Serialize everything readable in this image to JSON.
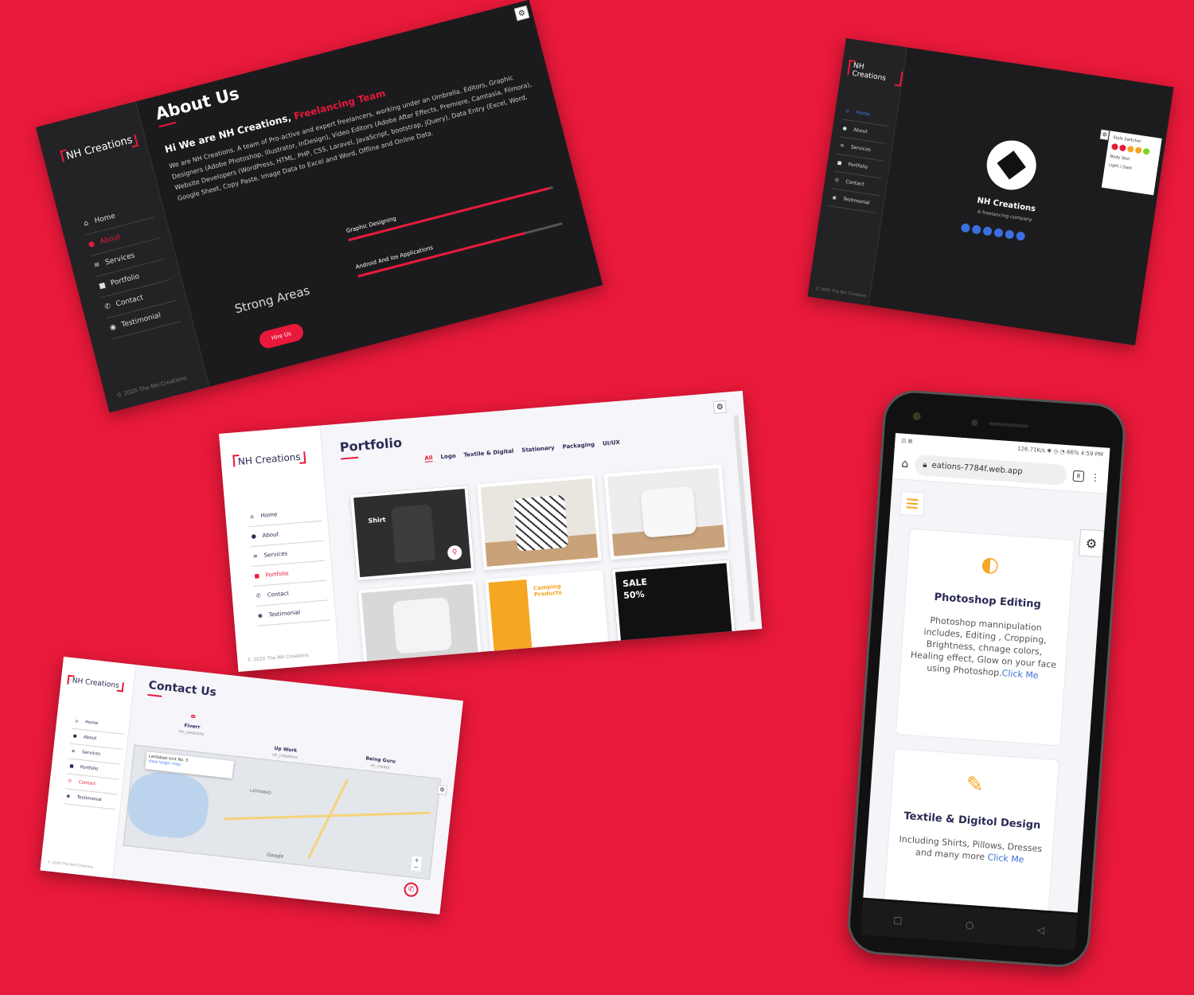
{
  "about_shot": {
    "logo": "NH Creations",
    "nav": [
      "Home",
      "About",
      "Services",
      "Portfolio",
      "Contact",
      "Testimonial"
    ],
    "copyright": "© 2020 The NH Creations",
    "title": "About Us",
    "intro_prefix": "Hi We are NH Creations,",
    "intro_highlight": "Freelancing Team",
    "description": "We are NH Creations. A team of Pro-active and expert freelancers, working under an Umbrella. Editors, Graphic Designers (Adobe Photoshop, Illustrator, InDesign), Video Editors (Adobe After Effects, Premiere, Camtasia, Filmora), Website Developers (WordPress, HTML, PHP, CSS, Laravel, JavaScript, bootstrap, jQuery), Data Entry (Excel, Word, Google Sheet, Copy Paste, Image Data to Excel and Word, Offline and Online Data.",
    "strong_areas": "Strong Areas",
    "hire_button": "Hire Us",
    "skills": [
      {
        "name": "Graphic Designing",
        "level": 0.98
      },
      {
        "name": "Android And Ios Applications",
        "level": 0.82
      }
    ]
  },
  "home_shot": {
    "logo": "NH Creations",
    "nav": [
      "Home",
      "About",
      "Services",
      "Portfolio",
      "Contact",
      "Testimonial"
    ],
    "copyright": "© 2020 The NH Creations",
    "name": "NH Creations",
    "tagline": "A freelancing company",
    "style_panel": {
      "title": "Style Switcher",
      "colors": [
        "#e8193a",
        "#e8193a",
        "#f5a623",
        "#f5a623",
        "#7ed321"
      ],
      "body_skin": "Body Skin",
      "option": "Light / Dark"
    }
  },
  "portfolio_shot": {
    "logo": "NH Creations",
    "nav": [
      "Home",
      "About",
      "Services",
      "Portfolio",
      "Contact",
      "Testimonial"
    ],
    "copyright": "© 2020 The NH Creations",
    "title": "Portfolio",
    "filters": [
      "All",
      "Logo",
      "Textile & Digital",
      "Stationary",
      "Packaging",
      "UI/UX"
    ],
    "card_caption": "Shirt",
    "camping_text": "Camping Products",
    "sale_text": "SALE",
    "sale_pct": "50%"
  },
  "contact_shot": {
    "logo": "NH Creations",
    "nav": [
      "Home",
      "About",
      "Services",
      "Portfolio",
      "Contact",
      "Testimonial"
    ],
    "copyright": "© 2020 The NH Creations",
    "title": "Contact Us",
    "info": [
      {
        "label": "Fiverr",
        "value": "nh_creations"
      },
      {
        "label": "Up Work",
        "value": "nh_creations"
      },
      {
        "label": "Being Guru",
        "value": "nh_creata"
      }
    ],
    "map_popup_title": "Latifabad Unit No. 5",
    "map_popup_link": "View larger map",
    "map_zone": "LATIFABAD",
    "map_brand": "Google"
  },
  "phone": {
    "status_left": "⊡ ⊠",
    "status_right": "126.71K/s ✱ ◷ ◔ 66% 4:59 PM",
    "url": "eations-7784f.web.app",
    "tab_count": "8",
    "services": [
      {
        "title": "Photoshop Editing",
        "text": "Photoshop mannipulation includes, Editing , Cropping, Brightness, chnage colors, Healing effect, Glow on your face using Photoshop.",
        "link": "Click Me"
      },
      {
        "title": "Textile & Digitol Design",
        "text": "Including Shirts, Pillows, Dresses and many more",
        "link": "Click Me"
      }
    ]
  }
}
